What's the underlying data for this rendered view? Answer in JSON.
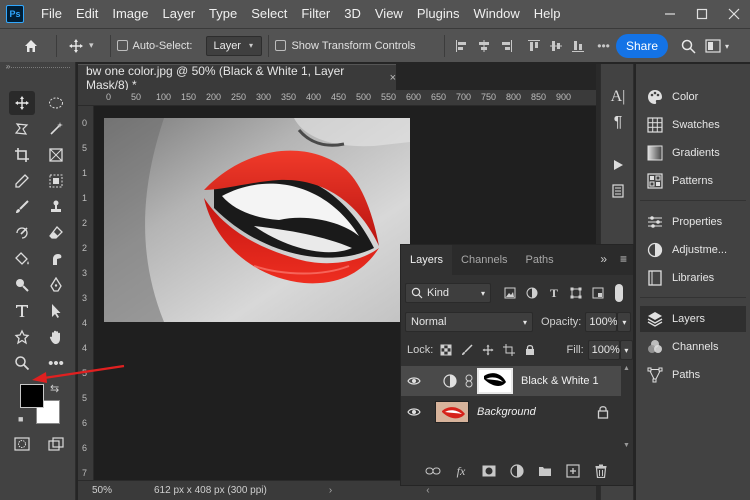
{
  "app": {
    "logo_text": "Ps",
    "menu": [
      "File",
      "Edit",
      "Image",
      "Layer",
      "Type",
      "Select",
      "Filter",
      "3D",
      "View",
      "Plugins",
      "Window",
      "Help"
    ]
  },
  "options": {
    "auto_select_label": "Auto-Select:",
    "auto_select_value": "Layer",
    "transform_label": "Show Transform Controls",
    "share_label": "Share"
  },
  "document": {
    "tab_title": "bw one color.jpg @ 50% (Black & White 1, Layer Mask/8) *",
    "close_glyph": "×",
    "ruler_top": [
      "0",
      "50",
      "100",
      "150",
      "200",
      "250",
      "300",
      "350",
      "400",
      "450",
      "500",
      "550",
      "600",
      "650",
      "700",
      "750",
      "800",
      "850",
      "900"
    ],
    "ruler_left": [
      "0",
      "5",
      "1",
      "1",
      "2",
      "2",
      "3",
      "3",
      "4",
      "4",
      "5",
      "5",
      "6",
      "6",
      "7"
    ],
    "zoom": "50%",
    "doc_size": "612 px x 408 px (300 ppi)"
  },
  "right_panel": {
    "items": [
      "Color",
      "Swatches",
      "Gradients",
      "Patterns",
      "Properties",
      "Adjustme...",
      "Libraries",
      "Layers",
      "Channels",
      "Paths"
    ]
  },
  "layers_panel": {
    "tabs": [
      "Layers",
      "Channels",
      "Paths"
    ],
    "filter_kind": "Kind",
    "blend_mode": "Normal",
    "opacity_label": "Opacity:",
    "opacity_value": "100%",
    "lock_label": "Lock:",
    "fill_label": "Fill:",
    "fill_value": "100%",
    "layers": [
      {
        "name": "Black & White 1"
      },
      {
        "name": "Background"
      }
    ]
  },
  "colors": {
    "foreground": "#000000",
    "background": "#ffffff",
    "accent": "#1473e6",
    "annotation_arrow": "#e02020"
  }
}
